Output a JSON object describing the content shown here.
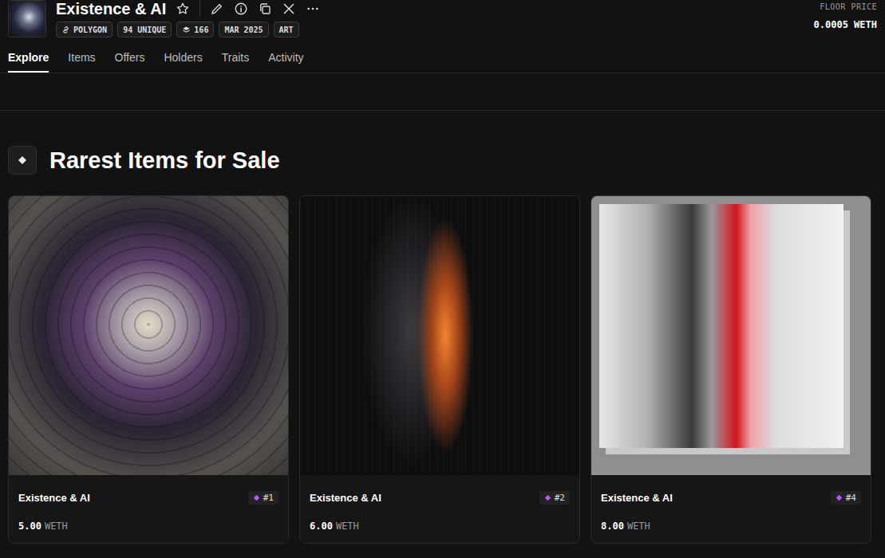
{
  "collection": {
    "name": "Existence & AI",
    "badges": [
      {
        "label": "POLYGON",
        "kind": "link"
      },
      {
        "label": "94 UNIQUE",
        "kind": "plain"
      },
      {
        "label": "166",
        "kind": "layers"
      },
      {
        "label": "MAR 2025",
        "kind": "plain"
      },
      {
        "label": "ART",
        "kind": "plain"
      }
    ]
  },
  "floor": {
    "label": "FLOOR PRICE",
    "value": "0.0005 WETH"
  },
  "tabs": [
    {
      "label": "Explore",
      "selected": true
    },
    {
      "label": "Items",
      "selected": false
    },
    {
      "label": "Offers",
      "selected": false
    },
    {
      "label": "Holders",
      "selected": false
    },
    {
      "label": "Traits",
      "selected": false
    },
    {
      "label": "Activity",
      "selected": false
    }
  ],
  "section": {
    "title": "Rarest Items for Sale"
  },
  "cards": [
    {
      "name": "Existence & AI",
      "rank": "#1",
      "price": "5.00",
      "currency": "WETH",
      "kind": "rings"
    },
    {
      "name": "Existence & AI",
      "rank": "#2",
      "price": "6.00",
      "currency": "WETH",
      "kind": "streak"
    },
    {
      "name": "Existence & AI",
      "rank": "#4",
      "price": "8.00",
      "currency": "WETH",
      "kind": "wall"
    }
  ]
}
